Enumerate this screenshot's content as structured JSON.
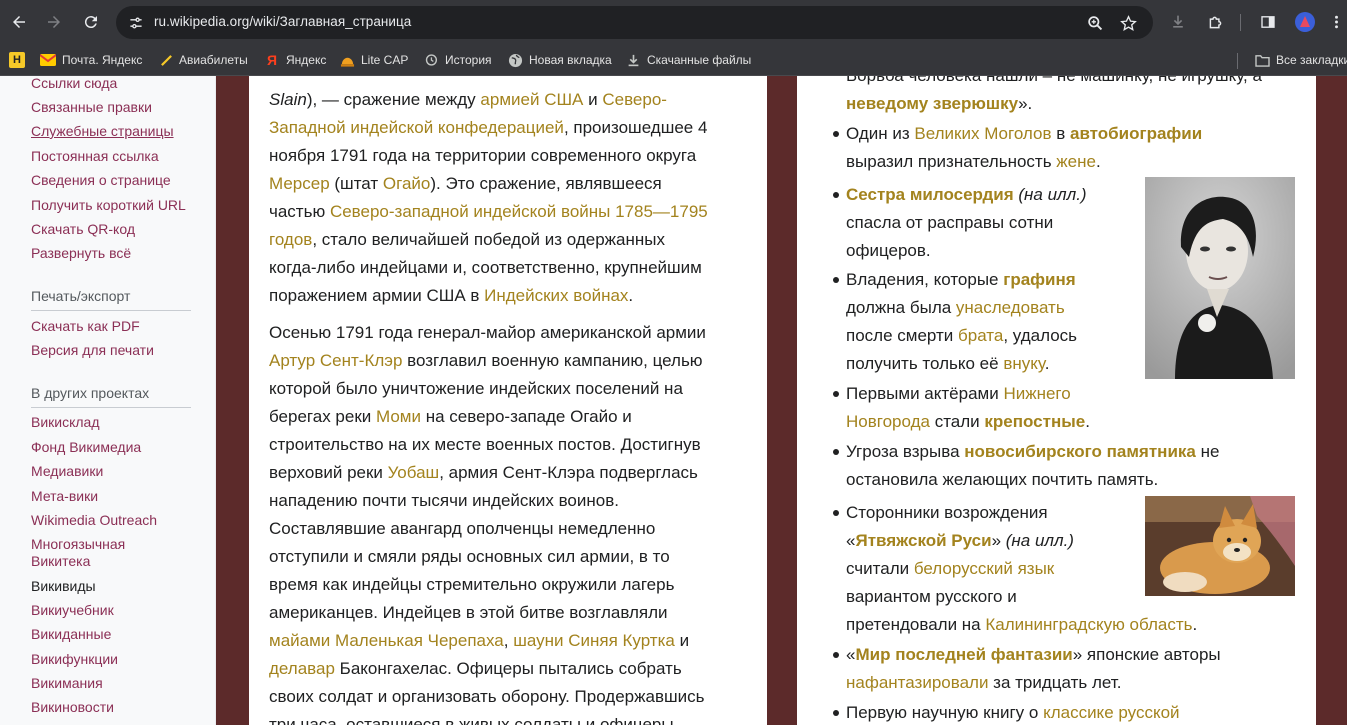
{
  "browser": {
    "url": "ru.wikipedia.org/wiki/Заглавная_страница",
    "colors": {
      "chrome": "#35363a",
      "omnibox": "#202124"
    },
    "icons": [
      "back-icon",
      "forward-icon",
      "reload-icon",
      "site-info-icon",
      "zoom-icon",
      "bookmark-star-icon",
      "download-icon",
      "extensions-icon",
      "sidepanel-icon",
      "profile-avatar",
      "menu-icon"
    ]
  },
  "bookmarks": {
    "items": [
      {
        "icon": "hh-icon",
        "label": ""
      },
      {
        "icon": "mail-icon",
        "label": "Почта. Яндекс"
      },
      {
        "icon": "plane-icon",
        "label": "Авиабилеты"
      },
      {
        "icon": "yandex-icon",
        "label": "Яндекс"
      },
      {
        "icon": "litecap-icon",
        "label": "Lite CAP"
      },
      {
        "icon": "history-icon",
        "label": "История"
      },
      {
        "icon": "globe-icon",
        "label": "Новая вкладка"
      },
      {
        "icon": "download-icon",
        "label": "Скачанные файлы"
      }
    ],
    "all_bookmarks": "Все закладки"
  },
  "sidebar": {
    "links_top": [
      "Ссылки сюда",
      "Связанные правки",
      "Служебные страницы",
      "Постоянная ссылка",
      "Сведения о странице",
      "Получить короткий URL",
      "Скачать QR-код",
      "Развернуть всё"
    ],
    "print_heading": "Печать/экспорт",
    "print_links": [
      "Скачать как PDF",
      "Версия для печати"
    ],
    "projects_heading": "В других проектах",
    "project_links": [
      "Викисклад",
      "Фонд Викимедиа",
      "Медиавики",
      "Мета-вики",
      "Wikimedia Outreach",
      "Многоязычная Викитека",
      "Викивиды",
      "Викиучебник",
      "Викиданные",
      "Викифункции",
      "Викимания",
      "Викиновости"
    ]
  },
  "article_left": {
    "p1": {
      "l1_it": "Slain",
      "l1_a": "), — сражение между ",
      "l1_link1": "армией США",
      "l1_b": " и ",
      "l1_link2": "Северо-",
      "l2_link": "Западной индейской конфедерацией",
      "l2_b": ", произошедшее 4",
      "l3": "ноября 1791 года на территории современного округа",
      "l4_link1": "Мерсер",
      "l4_a": " (штат ",
      "l4_link2": "Огайо",
      "l4_b": "). Это сражение, являвшееся",
      "l5_a": "частью ",
      "l5_link": "Северо-западной индейской войны 1785—1795",
      "l6_link": "годов",
      "l6_b": ", стало величайшей победой из одержанных",
      "l7": "когда-либо индейцами и, соответственно, крупнейшим",
      "l8_a": "поражением армии США в ",
      "l8_link": "Индейских войнах",
      "l8_b": "."
    },
    "p2": {
      "l1": "Осенью 1791 года генерал-майор американской армии",
      "l2_link": "Артур Сент-Клэр",
      "l2_b": " возглавил военную кампанию, целью",
      "l3": "которой было уничтожение индейских поселений на",
      "l4_a": "берегах реки ",
      "l4_link": "Моми",
      "l4_b": " на северо-западе Огайо и",
      "l5": "строительство на их месте военных постов. Достигнув",
      "l6_a": "верховий реки ",
      "l6_link": "Уобаш",
      "l6_b": ", армия Сент-Клэра подверглась",
      "l7": "нападению почти тысячи индейских воинов.",
      "l8": "Составлявшие авангард ополченцы немедленно",
      "l9": "отступили и смяли ряды основных сил армии, в то",
      "l10": "время как индейцы стремительно окружили лагерь",
      "l11": "американцев. Индейцев в этой битве возглавляли",
      "l12_link1": "майами Маленькая Черепаха",
      "l12_a": ", ",
      "l12_link2": "шауни Синяя Куртка",
      "l12_b": " и",
      "l13_link": "делавар",
      "l13_b": " Баконгахелас. Офицеры пытались собрать",
      "l14": "своих солдат и организовать оборону. Продержавшись",
      "l15": "три часа, оставшиеся в живых солдаты и офицеры"
    }
  },
  "article_right": {
    "i0": {
      "l1": "Борьба человека нашли – не машинку, не игрушку, а",
      "l2_link": "неведому зверюшку",
      "l2_b": "»."
    },
    "i1": {
      "a": "Один из ",
      "link1": "Великих Моголов",
      "b": " в ",
      "link2": "автобиографии",
      "l2_a": "выразил признательность ",
      "l2_link": "жене",
      "l2_b": "."
    },
    "i2": {
      "link": "Сестра милосердия",
      "it": " (на илл.)",
      "l2": "спасла от расправы сотни",
      "l3": "офицеров."
    },
    "i3": {
      "a": "Владения, которые ",
      "link": "графиня",
      "l2_a": "должна была ",
      "l2_link": "унаследовать",
      "l3_a": "после смерти ",
      "l3_link": "брата",
      "l3_b": ", удалось",
      "l4_a": "получить только её ",
      "l4_link": "внуку",
      "l4_b": "."
    },
    "i4": {
      "a": "Первыми актёрами ",
      "link": "Нижнего",
      "l2_link": "Новгорода",
      "l2_a": " стали ",
      "l2_link2": "крепостные",
      "l2_b": "."
    },
    "i5": {
      "a": "Угроза взрыва ",
      "link": "новосибирского памятника",
      "b": " не",
      "l2": "остановила желающих почтить память."
    },
    "i6": {
      "a": "Сторонники возрождения",
      "l2_q1": "«",
      "l2_link": "Ятвяжской Руси",
      "l2_q2": "»",
      "l2_it": " (на илл.)",
      "l3_a": "считали ",
      "l3_link": "белорусский язык",
      "l4": "вариантом русского и",
      "l5_a": "претендовали на ",
      "l5_link": "Калининградскую область",
      "l5_b": "."
    },
    "i7": {
      "q1": "«",
      "link": "Мир последней фантазии",
      "b": "» японские авторы",
      "l2_link": "нафантазировали",
      "l2_b": " за тридцать лет."
    },
    "i8": {
      "a": "Первую научную книгу о ",
      "link": "классике русской"
    }
  },
  "colors": {
    "link": "#a3831e",
    "sidebar_link": "#8b2f55",
    "background": "#5c2a2a"
  }
}
